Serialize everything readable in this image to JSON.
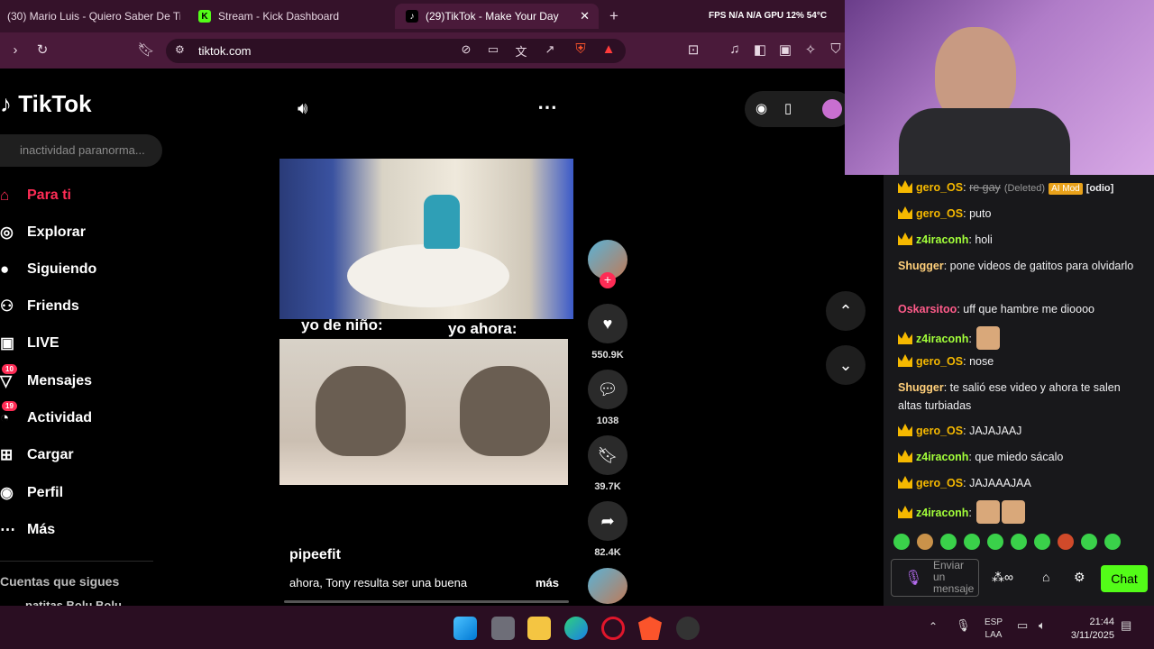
{
  "tabs": [
    {
      "label": "(30) Mario Luis - Quiero Saber De Ti",
      "active": false
    },
    {
      "label": "Stream - Kick Dashboard",
      "active": false
    },
    {
      "label": "(29)TikTok - Make Your Day",
      "active": true
    }
  ],
  "overlay_stats": "FPS  N/A  N/A  GPU 12%  54°C",
  "address": {
    "url": "tiktok.com"
  },
  "tiktok": {
    "logo": "TikTok",
    "search_placeholder": "inactividad paranorma...",
    "nav": [
      {
        "label": "Para ti",
        "icon": "home-icon",
        "active": true
      },
      {
        "label": "Explorar",
        "icon": "compass-icon"
      },
      {
        "label": "Siguiendo",
        "icon": "following-avatar-icon"
      },
      {
        "label": "Friends",
        "icon": "friends-icon"
      },
      {
        "label": "LIVE",
        "icon": "live-icon"
      },
      {
        "label": "Mensajes",
        "icon": "messages-icon",
        "badge": "10"
      },
      {
        "label": "Actividad",
        "icon": "activity-icon",
        "badge": "19"
      },
      {
        "label": "Cargar",
        "icon": "upload-icon"
      },
      {
        "label": "Perfil",
        "icon": "profile-icon"
      },
      {
        "label": "Más",
        "icon": "more-icon"
      }
    ],
    "following_header": "Cuentas que sigues",
    "following_first": "patitas Bolu Bolu",
    "video": {
      "caption_left": "yo de niño:",
      "caption_right": "yo ahora:",
      "author": "pipeefit",
      "description": "ahora, Tony resulta ser una buena",
      "more": "más"
    },
    "actions": {
      "likes": "550.9K",
      "comments": "1038",
      "saves": "39.7K",
      "shares": "82.4K"
    }
  },
  "chat": {
    "messages": [
      {
        "user": "gero_OS",
        "color": "#f5b800",
        "crown": true,
        "text": "re gay",
        "deleted": "(Deleted)",
        "tag": "AI Mod",
        "extra": "[odio]"
      },
      {
        "user": "gero_OS",
        "color": "#f5b800",
        "crown": true,
        "text": "puto"
      },
      {
        "user": "z4iraconh",
        "color": "#a3ff3a",
        "crown": true,
        "text": "holi"
      },
      {
        "user": "Shugger",
        "color": "#ffcf7a",
        "crown": false,
        "text": "pone videos de gatitos para olvidarlo"
      },
      {
        "user": "Oskarsitoo",
        "color": "#ff5b8a",
        "crown": false,
        "text": "uff que hambre me dioooo"
      },
      {
        "user": "z4iraconh",
        "color": "#a3ff3a",
        "crown": true,
        "text": "",
        "emotes": 1
      },
      {
        "user": "gero_OS",
        "color": "#f5b800",
        "crown": true,
        "text": "nose"
      },
      {
        "user": "Shugger",
        "color": "#ffcf7a",
        "crown": false,
        "text": "te salió ese video y ahora te salen altas turbiadas"
      },
      {
        "user": "gero_OS",
        "color": "#f5b800",
        "crown": true,
        "text": "JAJAJAAJ"
      },
      {
        "user": "z4iraconh",
        "color": "#a3ff3a",
        "crown": true,
        "text": "que miedo sácalo"
      },
      {
        "user": "gero_OS",
        "color": "#f5b800",
        "crown": true,
        "text": "JAJAAAJAA"
      },
      {
        "user": "z4iraconh",
        "color": "#a3ff3a",
        "crown": true,
        "text": "",
        "emotes": 2
      }
    ],
    "input_placeholder": "Enviar un mensaje",
    "send_label": "Chat"
  },
  "system": {
    "lang": "ESP",
    "layout": "LAA",
    "time": "21:44",
    "date": "3/11/2025"
  },
  "colors": {
    "accent": "#fe2c55",
    "kick_green": "#53fc18",
    "chrome_bg": "#4a1a3a"
  }
}
